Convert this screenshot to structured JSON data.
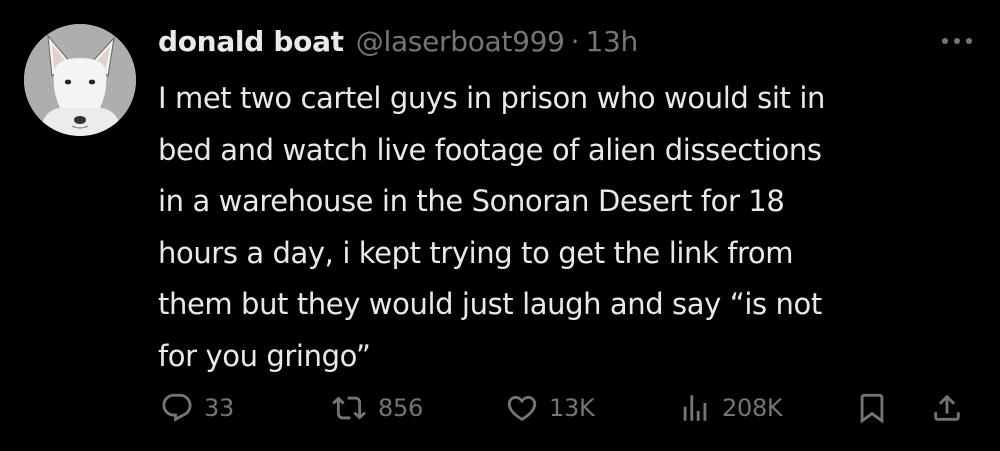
{
  "tweet": {
    "display_name": "donald boat",
    "handle": "@laserboat999",
    "separator": "·",
    "time": "13h",
    "text_lines": [
      "I met two cartel guys in prison who would sit in",
      "bed and watch live footage of alien dissections",
      "in a warehouse in the Sonoran Desert for 18",
      "hours a day, i kept trying to get the link from",
      "them but they would just laugh and say “is not",
      "for you gringo”"
    ],
    "actions": {
      "replies": "33",
      "retweets": "856",
      "likes": "13K",
      "views": "208K"
    }
  },
  "icons": {
    "avatar": "bull-terrier-avatar",
    "more": "more-icon",
    "reply": "reply-icon",
    "retweet": "retweet-icon",
    "like": "heart-icon",
    "views": "views-icon",
    "bookmark": "bookmark-icon",
    "share": "share-icon"
  },
  "colors": {
    "background": "#000000",
    "text": "#e7e9ea",
    "secondary": "#71767b"
  }
}
